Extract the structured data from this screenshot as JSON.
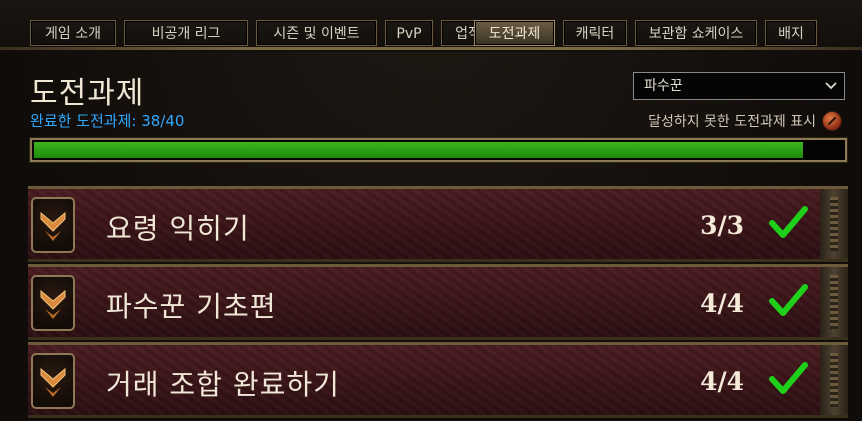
{
  "tabs": [
    {
      "label": "게임 소개",
      "active": false
    },
    {
      "label": "비공개 리그",
      "active": false
    },
    {
      "label": "시즌 및 이벤트",
      "active": false
    },
    {
      "label": "PvP",
      "active": false
    },
    {
      "label": "업적",
      "active": false
    },
    {
      "label": "도전과제",
      "active": true
    },
    {
      "label": "캐릭터",
      "active": false
    },
    {
      "label": "보관함 쇼케이스",
      "active": false
    },
    {
      "label": "배지",
      "active": false
    }
  ],
  "header": {
    "title": "도전과제",
    "progress_label": "완료한 도전과제: 38/40",
    "completed": 38,
    "total": 40
  },
  "filter": {
    "class_selected": "파수꾼",
    "show_incomplete_label": "달성하지 못한 도전과제 표시"
  },
  "achievements": [
    {
      "name": "요령 익히기",
      "count": "3/3",
      "completed": true,
      "icon": "chevron-emblem-icon"
    },
    {
      "name": "파수꾼 기초편",
      "count": "4/4",
      "completed": true,
      "icon": "chevron-emblem-icon"
    },
    {
      "name": "거래 조합 완료하기",
      "count": "4/4",
      "completed": true,
      "icon": "chevron-emblem-icon"
    }
  ],
  "colors": {
    "accent_blue": "#2fa8ff",
    "progress_green": "#2ea516",
    "check_green": "#1fd01a",
    "active_tab": "#5a4d38"
  }
}
